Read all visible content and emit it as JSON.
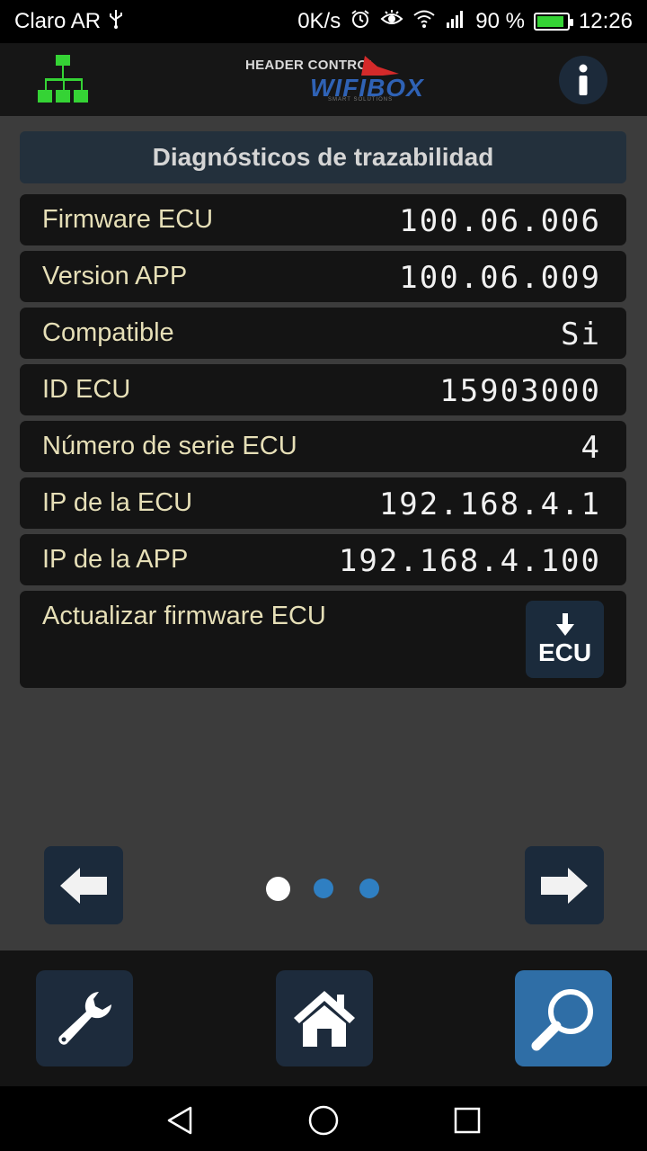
{
  "status_bar": {
    "carrier": "Claro AR",
    "usb_icon": "usb-icon",
    "speed": "0K/s",
    "signal_icon": "cell-signal-icon",
    "battery_percent": "90 %",
    "battery_level": 0.9,
    "time": "12:26"
  },
  "header": {
    "logo_top": "HEADER CONTROL",
    "logo_main": "WIFIBOX",
    "logo_sub": "SMART SOLUTIONS",
    "info_label": "i",
    "network_icon": "network-tree-icon"
  },
  "section": {
    "title": "Diagnósticos de trazabilidad"
  },
  "rows": [
    {
      "label": "Firmware ECU",
      "value": "100.06.006"
    },
    {
      "label": "Version APP",
      "value": "100.06.009"
    },
    {
      "label": "Compatible",
      "value": "Si"
    },
    {
      "label": "ID ECU",
      "value": "15903000"
    },
    {
      "label": "Número de serie ECU",
      "value": "4"
    },
    {
      "label": "IP de la ECU",
      "value": "192.168.4.1"
    },
    {
      "label": "IP de la APP",
      "value": "192.168.4.100"
    }
  ],
  "update": {
    "label": "Actualizar firmware ECU",
    "button_label": "ECU"
  },
  "pager": {
    "current_page": 1,
    "total_pages": 3
  },
  "colors": {
    "accent": "#2f6ea6",
    "button_bg": "#1d2b3c",
    "row_label": "#e6dfb7",
    "network_icon": "#35d335",
    "logo_blue": "#2f62b5",
    "logo_red": "#d42a2a"
  }
}
